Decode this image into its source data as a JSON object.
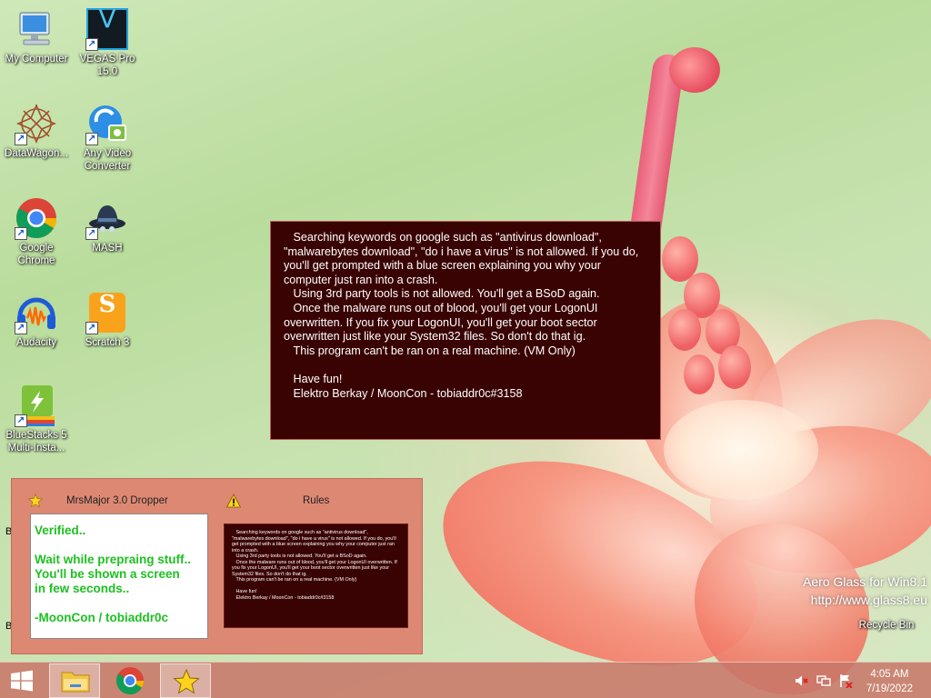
{
  "desktop": {
    "icons": [
      {
        "label": "My Computer"
      },
      {
        "label": "VEGAS Pro 15.0"
      },
      {
        "label": "DataWagon..."
      },
      {
        "label": "Any Video Converter"
      },
      {
        "label": "Google Chrome"
      },
      {
        "label": "MASH"
      },
      {
        "label": "Audacity"
      },
      {
        "label": "Scratch 3"
      },
      {
        "label": "BlueStacks 5 Multi-Insta..."
      }
    ],
    "recycle_bin": "Recycle Bin",
    "edge_letter": "B",
    "vegas_glyph": "V",
    "scratch_glyph": "S",
    "watermark_line1": "Aero Glass for Win8.1",
    "watermark_line2": "http://www.glass8.eu"
  },
  "rules_window": {
    "text": "   Searching keywords on google such as \"antivirus download\", \"malwarebytes download\", \"do i have a virus\" is not allowed. If you do, you'll get prompted with a blue screen explaining you why your computer just ran into a crash.\n   Using 3rd party tools is not allowed. You'll get a BSoD again.\n   Once the malware runs out of blood, you'll get your LogonUI overwritten. If you fix your LogonUI, you'll get your boot sector overwritten just like your System32 files. So don't do that ig.\n   This program can't be ran on a real machine. (VM Only)\n\n   Have fun!\n   Elektro Berkay / MoonCon - tobiaddr0c#3158"
  },
  "dropper_window": {
    "title": "MrsMajor 3.0 Dropper",
    "rules_title": "Rules",
    "status_text": "Verified..\n\nWait while prepraing stuff..\nYou'll be shown a screen\nin few seconds..\n\n-MoonCon / tobiaddr0c"
  },
  "taskbar": {
    "time": "4:05 AM",
    "date": "7/19/2022"
  },
  "colors": {
    "rules_bg": "#3a0303",
    "verified_text": "#1ec022",
    "taskbar": "#c87869"
  }
}
